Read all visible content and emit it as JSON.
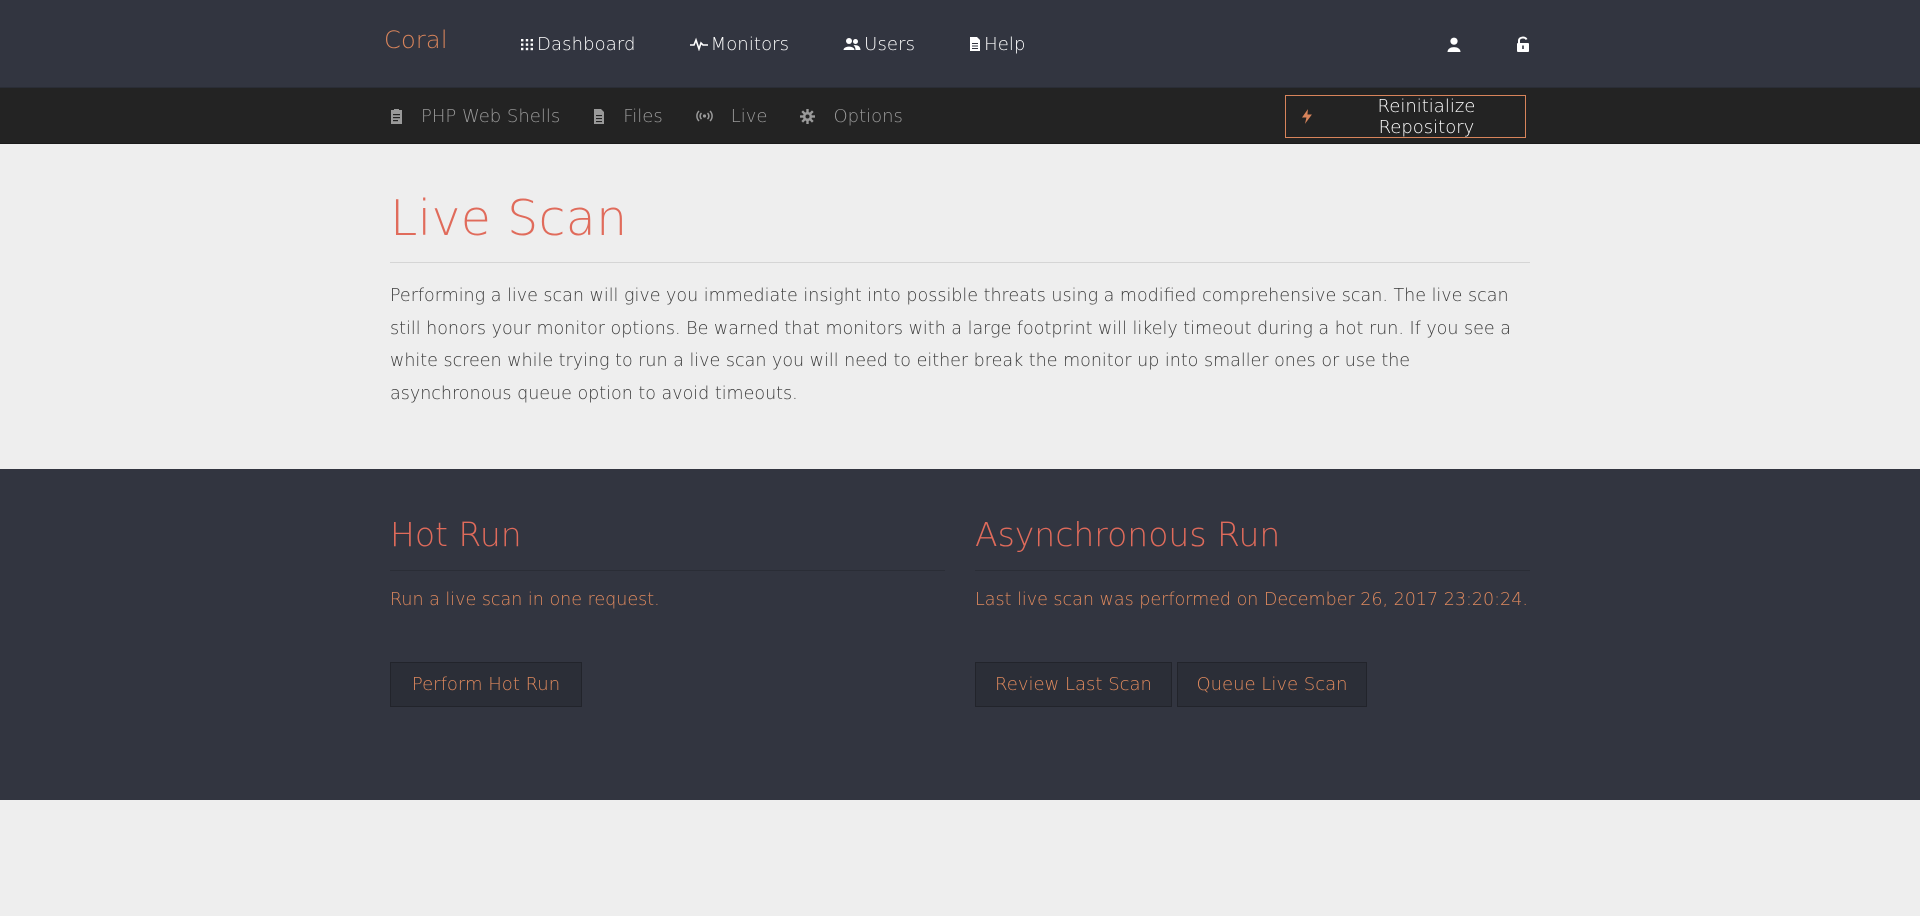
{
  "brand": "Coral",
  "top_nav": [
    {
      "label": "Dashboard",
      "icon": "grid-icon"
    },
    {
      "label": "Monitors",
      "icon": "pulse-icon"
    },
    {
      "label": "Users",
      "icon": "users-icon"
    },
    {
      "label": "Help",
      "icon": "document-icon"
    }
  ],
  "top_right_icons": [
    "user-icon",
    "unlock-icon"
  ],
  "sub_nav": [
    {
      "label": "PHP Web Shells",
      "icon": "clipboard-icon"
    },
    {
      "label": "Files",
      "icon": "file-icon"
    },
    {
      "label": "Live",
      "icon": "broadcast-icon"
    },
    {
      "label": "Options",
      "icon": "gear-icon"
    }
  ],
  "reinit_label": "Reinitialize Repository",
  "page": {
    "title": "Live Scan",
    "description": "Performing a live scan will give you immediate insight into possible threats using a modified comprehensive scan. The live scan still honors your monitor options. Be warned that monitors with a large footprint will likely timeout during a hot run. If you see a white screen while trying to run a live scan you will need to either break the monitor up into smaller ones or use the asynchronous queue option to avoid timeouts."
  },
  "hot_run": {
    "title": "Hot Run",
    "text": "Run a live scan in one request.",
    "button": "Perform Hot Run"
  },
  "async_run": {
    "title": "Asynchronous Run",
    "text": "Last live scan was performed on December 26, 2017 23:20:24.",
    "review_button": "Review Last Scan",
    "queue_button": "Queue Live Scan"
  },
  "colors": {
    "accent": "#e06b5b",
    "brand": "#d8845b",
    "dark_bg": "#323540",
    "subbar_bg": "#232323",
    "page_bg": "#eeeeee"
  }
}
